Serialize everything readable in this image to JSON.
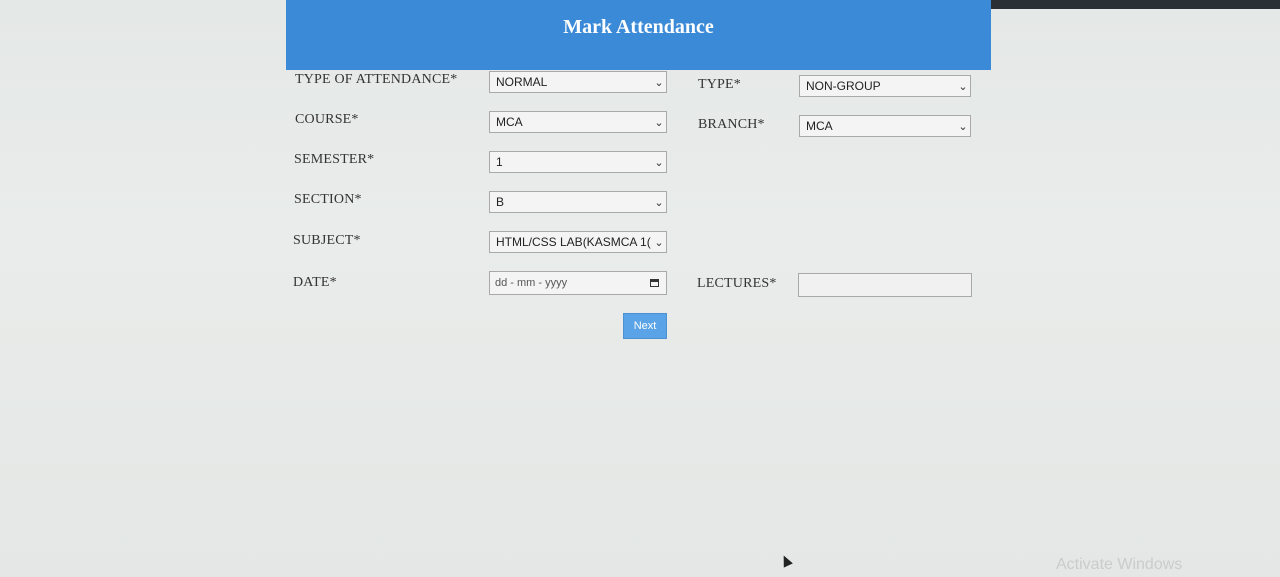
{
  "header": {
    "title": "Mark Attendance"
  },
  "form": {
    "type_of_attendance": {
      "label": "TYPE OF ATTENDANCE*",
      "value": "NORMAL"
    },
    "type": {
      "label": "TYPE*",
      "value": "NON-GROUP"
    },
    "course": {
      "label": "COURSE*",
      "value": "MCA"
    },
    "branch": {
      "label": "BRANCH*",
      "value": "MCA"
    },
    "semester": {
      "label": "SEMESTER*",
      "value": "1"
    },
    "section": {
      "label": "SECTION*",
      "value": "B"
    },
    "subject": {
      "label": "SUBJECT*",
      "value": "HTML/CSS LAB(KASMCA 1("
    },
    "date": {
      "label": "DATE*",
      "placeholder": "dd - mm - yyyy"
    },
    "lectures": {
      "label": "LECTURES*",
      "value": ""
    },
    "next_label": "Next"
  },
  "os": {
    "watermark": "Activate Windows"
  },
  "colors": {
    "header_bg": "#3a8ad8",
    "button_bg": "#5aa3e6"
  },
  "icons": {
    "dropdown": "chevron-down-icon",
    "calendar": "calendar-icon"
  }
}
